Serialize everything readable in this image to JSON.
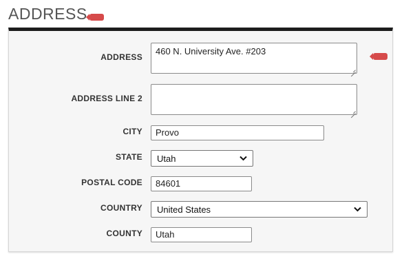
{
  "section": {
    "title": "ADDRESS"
  },
  "form": {
    "address": {
      "label": "ADDRESS",
      "value": "460 N. University Ave. #203"
    },
    "address_line_2": {
      "label": "ADDRESS LINE 2",
      "value": ""
    },
    "city": {
      "label": "CITY",
      "value": "Provo"
    },
    "state": {
      "label": "STATE",
      "value": "Utah"
    },
    "postal_code": {
      "label": "POSTAL CODE",
      "value": "84601"
    },
    "country": {
      "label": "COUNTRY",
      "value": "United States"
    },
    "county": {
      "label": "COUNTY",
      "value": "Utah"
    }
  },
  "colors": {
    "required_flag": "#d64a4a",
    "panel_top_border": "#1c1c1c",
    "panel_background": "#f6f6f6"
  },
  "icons": {
    "required": "required-flag-icon",
    "dropdown": "chevron-down-icon"
  }
}
